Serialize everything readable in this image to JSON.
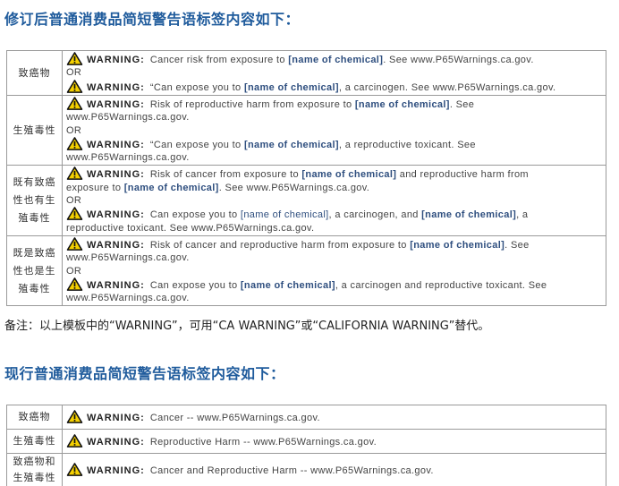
{
  "heading_revised": "修订后普通消费品简短警告语标签内容如下：",
  "note": "备注：以上模板中的“WARNING”，可用“CA WARNING”或“CALIFORNIA WARNING”替代。",
  "heading_current": "现行普通消费品简短警告语标签内容如下：",
  "icon": "warning-triangle-icon",
  "colors": {
    "heading": "#1f5b9c",
    "triangle_fill": "#f5d000",
    "chemical": "#2f4f7f",
    "border": "#9a9a9a"
  },
  "revised": {
    "row1": {
      "cat": "致癌物",
      "a_warn": "WARNING:",
      "a_pre": "Cancer risk from exposure to",
      "a_chem": "[name of chemical]",
      "a_post": ". See www.P65Warnings.ca.gov.",
      "or": "OR",
      "b_warn": "WARNING:",
      "b_pre": "“Can expose you to",
      "b_chem": "[name of chemical]",
      "b_post": ", a carcinogen. See www.P65Warnings.ca.gov."
    },
    "row2": {
      "cat1": "生殖毒性",
      "a_warn": "WARNING:",
      "a_pre": "Risk of reproductive harm from exposure to",
      "a_chem": "[name of chemical]",
      "a_post": ". See",
      "a_cont": "www.P65Warnings.ca.gov.",
      "or": "OR",
      "b_warn": "WARNING:",
      "b_pre": "“Can expose you to",
      "b_chem": "[name of chemical]",
      "b_post": ", a reproductive toxicant. See",
      "b_cont": "www.P65Warnings.ca.gov."
    },
    "row3": {
      "cat1": "既有致癌",
      "cat2": "性也有生",
      "cat3": "殖毒性",
      "a_warn": "WARNING:",
      "a_pre": "Risk of cancer from exposure to",
      "a_chem": "[name of chemical]",
      "a_post": "and reproductive harm from",
      "a_cont_pre": "exposure to",
      "a_cont_chem": "[name of chemical]",
      "a_cont_post": ". See www.P65Warnings.ca.gov.",
      "or": "OR",
      "b_warn": "WARNING:",
      "b_pre": "Can expose you to",
      "b_chem1": "[name of chemical]",
      "b_mid": ", a carcinogen, and",
      "b_chem2": "[name of chemical]",
      "b_post": ", a",
      "b_cont": "reproductive toxicant. See www.P65Warnings.ca.gov."
    },
    "row4": {
      "cat1": "既是致癌",
      "cat2": "性也是生",
      "cat3": "殖毒性",
      "a_warn": "WARNING:",
      "a_pre": "Risk of cancer and reproductive harm from exposure to",
      "a_chem": "[name of chemical]",
      "a_post": ". See",
      "a_cont": "www.P65Warnings.ca.gov.",
      "or": "OR",
      "b_warn": "WARNING:",
      "b_pre": "Can expose you to",
      "b_chem": "[name of chemical]",
      "b_post": ", a carcinogen and reproductive toxicant. See",
      "b_cont": "www.P65Warnings.ca.gov."
    }
  },
  "current": {
    "row1": {
      "cat": "致癌物",
      "warn": "WARNING:",
      "text": "Cancer -- www.P65Warnings.ca.gov."
    },
    "row2": {
      "cat": "生殖毒性",
      "warn": "WARNING:",
      "text": "Reproductive Harm -- www.P65Warnings.ca.gov."
    },
    "row3": {
      "cat1": "致癌物和",
      "cat2": "生殖毒性",
      "warn": "WARNING:",
      "text": "Cancer and Reproductive Harm -- www.P65Warnings.ca.gov."
    }
  }
}
